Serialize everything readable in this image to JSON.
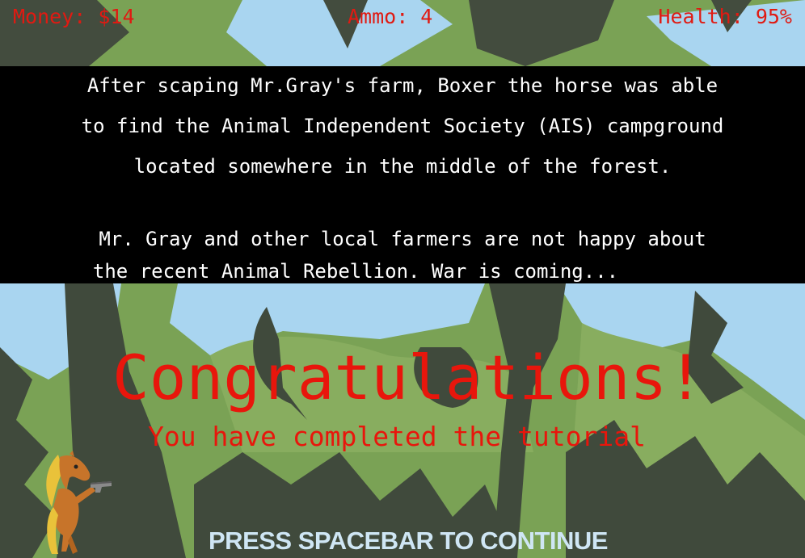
{
  "hud": {
    "money": "Money: $14",
    "ammo": "Ammo: 4",
    "health": "Health: 95%"
  },
  "story": {
    "lines": [
      "After scaping Mr.Gray's farm, Boxer the horse was able",
      "to find the Animal Independent Society (AIS) campground",
      "located somewhere in the middle of the forest.",
      "Mr. Gray and other local farmers are not happy about",
      "the recent Animal Rebellion. War is coming..."
    ]
  },
  "banner": {
    "title": "Congratulations!",
    "subtitle": "You have completed the tutorial"
  },
  "prompt": "PRESS SPACEBAR TO CONTINUE",
  "colors": {
    "sky": "#a9d5f0",
    "foliage": "#7aa255",
    "tree_dark": "#404a3c",
    "hud_text": "#e01a12",
    "congrats_text": "#e8160c",
    "prompt_text": "#cfe6f4"
  },
  "icons": [
    "horse-with-gun-sprite"
  ]
}
